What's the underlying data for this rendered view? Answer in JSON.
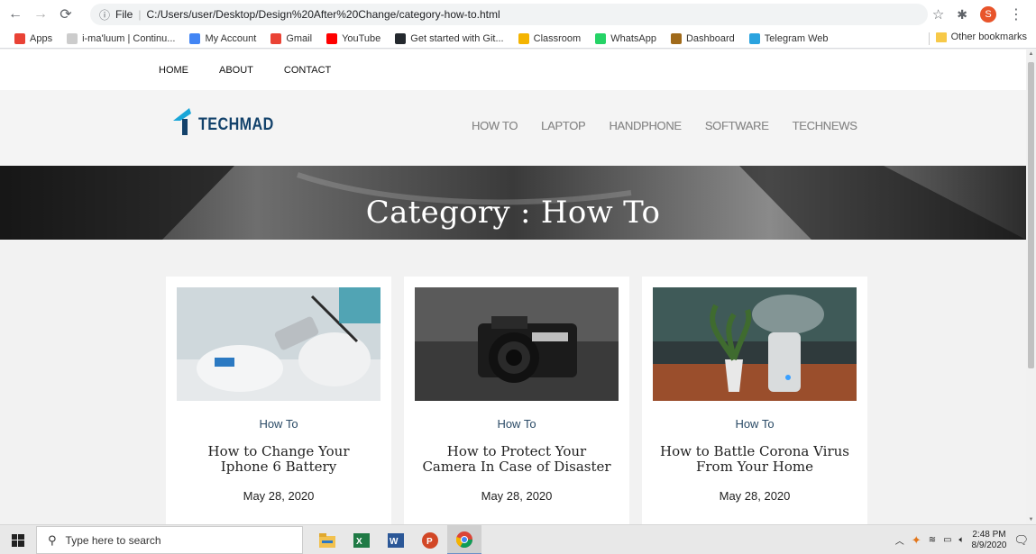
{
  "browser": {
    "address": "C:/Users/user/Desktop/Design%20After%20Change/category-how-to.html",
    "scheme_label": "File",
    "profile_initial": "S"
  },
  "bookmarks": [
    {
      "label": "Apps",
      "color": "#e94235"
    },
    {
      "label": "i-ma'luum | Continu...",
      "color": "#cccccc"
    },
    {
      "label": "My Account",
      "color": "#4285f4"
    },
    {
      "label": "Gmail",
      "color": "#ea4335"
    },
    {
      "label": "YouTube",
      "color": "#ff0000"
    },
    {
      "label": "Get started with Git...",
      "color": "#24292e"
    },
    {
      "label": "Classroom",
      "color": "#f4b400"
    },
    {
      "label": "WhatsApp",
      "color": "#25d366"
    },
    {
      "label": "Dashboard",
      "color": "#a06a1a"
    },
    {
      "label": "Telegram Web",
      "color": "#2aa3df"
    }
  ],
  "other_bookmarks": "Other bookmarks",
  "topnav": [
    "HOME",
    "ABOUT",
    "CONTACT"
  ],
  "logo_text": "TECHMAD",
  "mainnav": [
    "HOW TO",
    "LAPTOP",
    "HANDPHONE",
    "SOFTWARE",
    "TECHNEWS"
  ],
  "hero_title": "Category : How To",
  "cards": [
    {
      "category": "How To",
      "title_line1": "How to Change Your",
      "title_line2": "Iphone 6 Battery",
      "date": "May 28, 2020"
    },
    {
      "category": "How To",
      "title_line1": "How to Protect Your",
      "title_line2": "Camera In Case of Disaster",
      "date": "May 28, 2020"
    },
    {
      "category": "How To",
      "title_line1": "How to Battle Corona Virus",
      "title_line2": "From Your Home",
      "date": "May 28, 2020"
    }
  ],
  "taskbar": {
    "search_placeholder": "Type here to search",
    "time": "2:48 PM",
    "date": "8/9/2020"
  },
  "colors": {
    "logo": "#13426b",
    "category_link": "#2a4a66"
  }
}
